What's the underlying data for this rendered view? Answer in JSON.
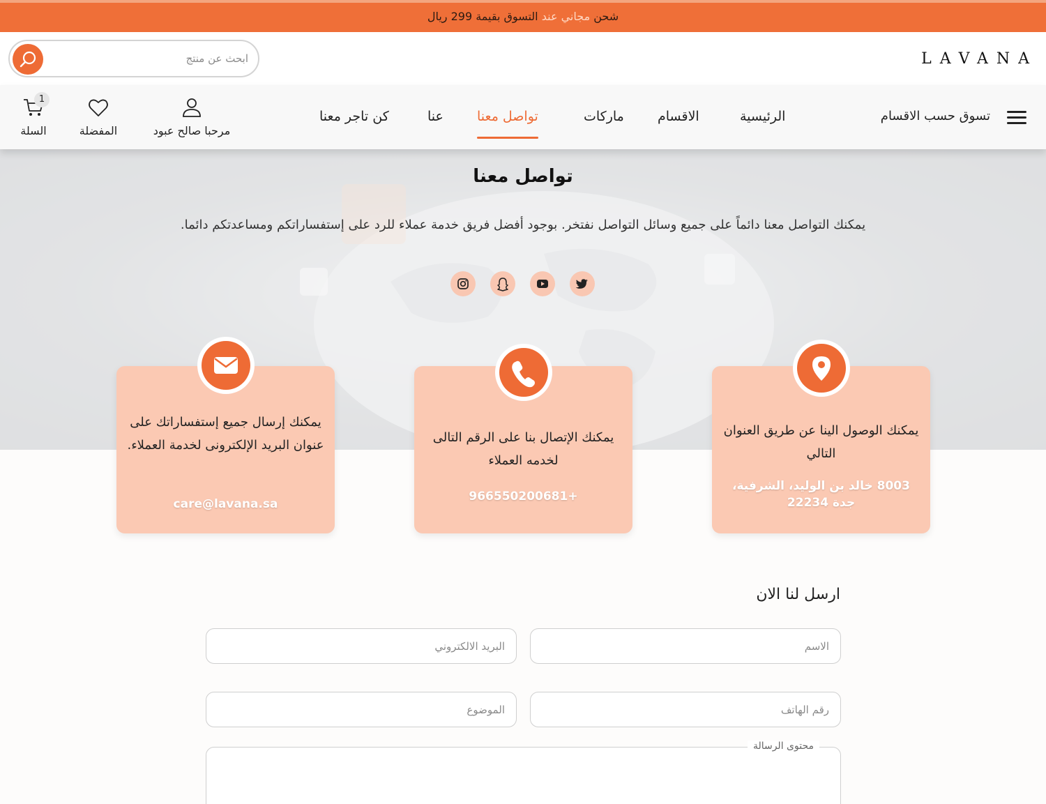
{
  "promo": {
    "word1": "شحن",
    "word2": "مجاني",
    "word3": "عند",
    "rest": "التسوق بقيمة 299 ريال"
  },
  "brand": {
    "logo": "LAVANA"
  },
  "search": {
    "placeholder": "ابحث عن منتج"
  },
  "nav": {
    "shop_by_category": "تسوق حسب الاقسام",
    "links": [
      "الرئيسية",
      "الاقسام",
      "ماركات",
      "تواصل معنا",
      "عنا",
      "كن تاجر معنا"
    ],
    "active_link": "تواصل معنا",
    "user_greeting": "مرحبا صالح عبود",
    "favorites": "المفضلة",
    "cart": "السلة",
    "cart_count": "1"
  },
  "hero": {
    "title": "تواصل معنا",
    "description": "يمكنك التواصل معنا دائماً على جميع وسائل التواصل نفتخر. بوجود أفضل فريق خدمة عملاء للرد على إستفساراتكم ومساعدتكم دائما.",
    "socials": [
      "instagram-icon",
      "snapchat-icon",
      "youtube-icon",
      "twitter-icon"
    ]
  },
  "cards": {
    "email": {
      "icon": "envelope-icon",
      "text": "يمكنك إرسال جميع إستفساراتك على عنوان البريد الإلكترونى لخدمة العملاء.",
      "value": "care@lavana.sa"
    },
    "phone": {
      "icon": "phone-icon",
      "text": "يمكنك الإتصال بنا على الرقم التالى لخدمه العملاء",
      "value": "+966550200681"
    },
    "address": {
      "icon": "location-pin-icon",
      "text": "يمكنك الوصول الينا عن طريق العنوان التالي",
      "value": "8003 خالد بن الوليد، الشرفية، جدة 22234"
    }
  },
  "colors": {
    "accent": "#ee6b35",
    "card_bg": "#fbc9b3",
    "social_bg": "#f9c7b2"
  },
  "form": {
    "title": "ارسل لنا الان",
    "name_placeholder": "الاسم",
    "email_placeholder": "البريد الالكتروني",
    "phone_placeholder": "رقم الهاتف",
    "subject_placeholder": "الموضوع",
    "message_label": "محتوى الرسالة"
  }
}
